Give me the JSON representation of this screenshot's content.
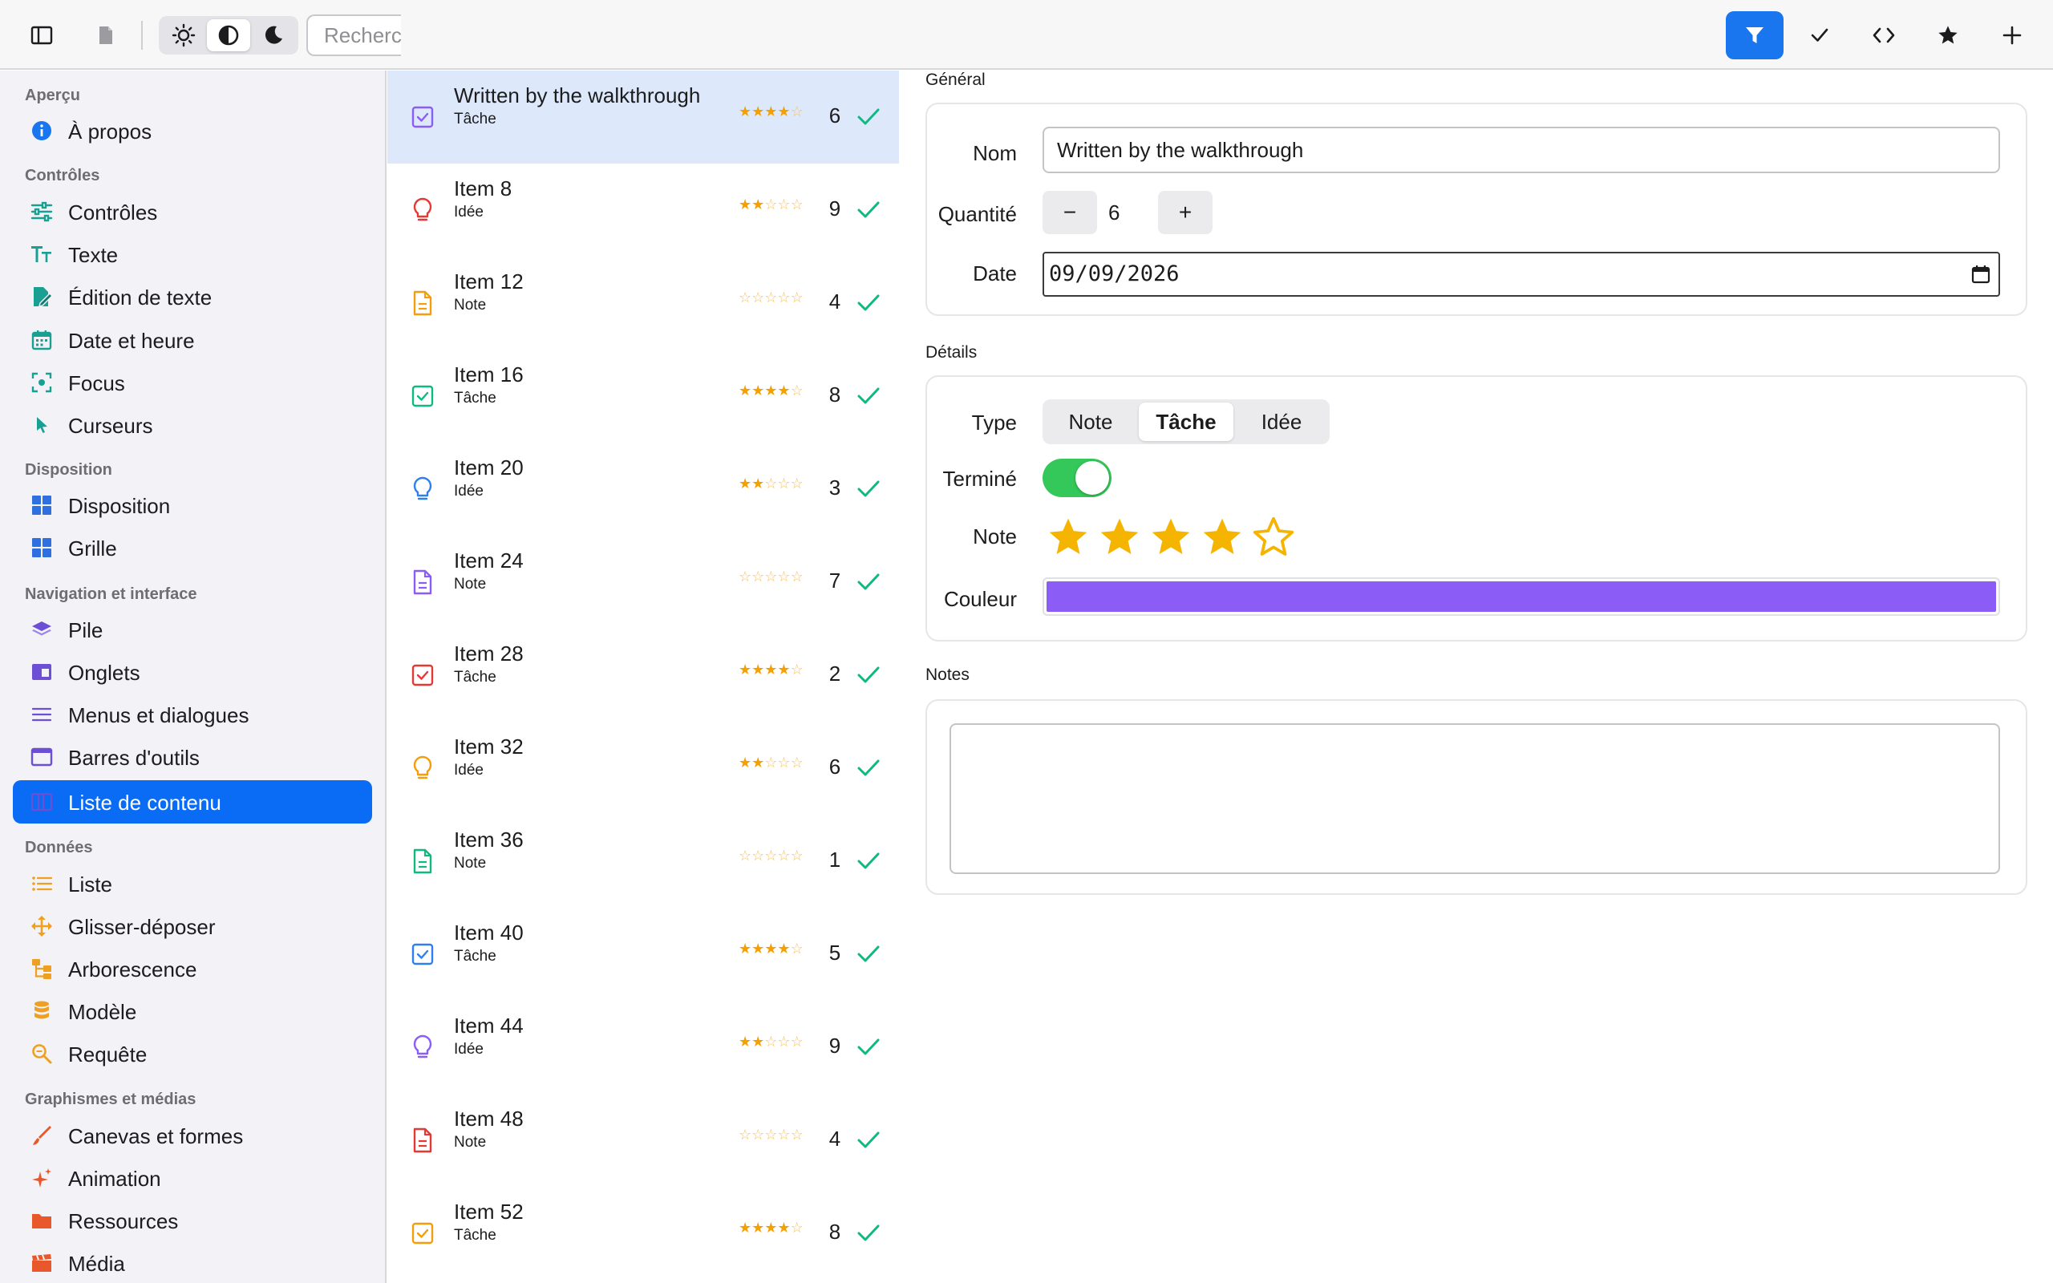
{
  "toolbar": {
    "search_placeholder": "Recherche",
    "colors": {
      "accent": "#1976ee"
    }
  },
  "sidebar": {
    "sections": [
      {
        "title": "Aperçu",
        "items": [
          {
            "label": "À propos",
            "icon": "info-icon"
          }
        ]
      },
      {
        "title": "Contrôles",
        "items": [
          {
            "label": "Contrôles",
            "icon": "sliders-icon"
          },
          {
            "label": "Texte",
            "icon": "text-format-icon"
          },
          {
            "label": "Édition de texte",
            "icon": "edit-doc-icon"
          },
          {
            "label": "Date et heure",
            "icon": "calendar-icon"
          },
          {
            "label": "Focus",
            "icon": "focus-icon"
          },
          {
            "label": "Curseurs",
            "icon": "cursor-icon"
          }
        ]
      },
      {
        "title": "Disposition",
        "items": [
          {
            "label": "Disposition",
            "icon": "layout-icon"
          },
          {
            "label": "Grille",
            "icon": "grid-icon"
          }
        ]
      },
      {
        "title": "Navigation et interface",
        "items": [
          {
            "label": "Pile",
            "icon": "stack-icon"
          },
          {
            "label": "Onglets",
            "icon": "tabs-icon"
          },
          {
            "label": "Menus et dialogues",
            "icon": "menu-icon"
          },
          {
            "label": "Barres d'outils",
            "icon": "toolbar-icon"
          },
          {
            "label": "Liste de contenu",
            "icon": "split-view-icon"
          }
        ]
      },
      {
        "title": "Données",
        "items": [
          {
            "label": "Liste",
            "icon": "list-icon"
          },
          {
            "label": "Glisser-déposer",
            "icon": "drag-icon"
          },
          {
            "label": "Arborescence",
            "icon": "tree-icon"
          },
          {
            "label": "Modèle",
            "icon": "database-icon"
          },
          {
            "label": "Requête",
            "icon": "search-doc-icon"
          }
        ]
      },
      {
        "title": "Graphismes et médias",
        "items": [
          {
            "label": "Canevas et formes",
            "icon": "brush-icon"
          },
          {
            "label": "Animation",
            "icon": "sparkle-icon"
          },
          {
            "label": "Ressources",
            "icon": "folder-icon"
          },
          {
            "label": "Média",
            "icon": "clapper-icon"
          }
        ]
      }
    ],
    "selected": "Liste de contenu"
  },
  "list": {
    "items": [
      {
        "title": "Written by the walkthrough",
        "type": "Tâche",
        "rating": 4,
        "qty": "6",
        "done": true,
        "icon": "task-icon",
        "color": "#8b5cf6",
        "selected": true
      },
      {
        "title": "Item 8",
        "type": "Idée",
        "rating": 2,
        "qty": "9",
        "done": true,
        "icon": "idea-icon",
        "color": "#e53935"
      },
      {
        "title": "Item 12",
        "type": "Note",
        "rating": 0,
        "qty": "4",
        "done": true,
        "icon": "note-icon",
        "color": "#f59e0b"
      },
      {
        "title": "Item 16",
        "type": "Tâche",
        "rating": 4,
        "qty": "8",
        "done": true,
        "icon": "task-icon",
        "color": "#10b981"
      },
      {
        "title": "Item 20",
        "type": "Idée",
        "rating": 2,
        "qty": "3",
        "done": true,
        "icon": "idea-icon",
        "color": "#2f80ed"
      },
      {
        "title": "Item 24",
        "type": "Note",
        "rating": 0,
        "qty": "7",
        "done": true,
        "icon": "note-icon",
        "color": "#8b5cf6"
      },
      {
        "title": "Item 28",
        "type": "Tâche",
        "rating": 4,
        "qty": "2",
        "done": true,
        "icon": "task-icon",
        "color": "#e53935"
      },
      {
        "title": "Item 32",
        "type": "Idée",
        "rating": 2,
        "qty": "6",
        "done": true,
        "icon": "idea-icon",
        "color": "#f59e0b"
      },
      {
        "title": "Item 36",
        "type": "Note",
        "rating": 0,
        "qty": "1",
        "done": true,
        "icon": "note-icon",
        "color": "#10b981"
      },
      {
        "title": "Item 40",
        "type": "Tâche",
        "rating": 4,
        "qty": "5",
        "done": true,
        "icon": "task-icon",
        "color": "#2f80ed"
      },
      {
        "title": "Item 44",
        "type": "Idée",
        "rating": 2,
        "qty": "9",
        "done": true,
        "icon": "idea-icon",
        "color": "#8b5cf6"
      },
      {
        "title": "Item 48",
        "type": "Note",
        "rating": 0,
        "qty": "4",
        "done": true,
        "icon": "note-icon",
        "color": "#e53935"
      },
      {
        "title": "Item 52",
        "type": "Tâche",
        "rating": 4,
        "qty": "8",
        "done": true,
        "icon": "task-icon",
        "color": "#f59e0b"
      }
    ]
  },
  "detail": {
    "general": {
      "title": "Général",
      "name_label": "Nom",
      "name_value": "Written by the walkthrough",
      "qty_label": "Quantité",
      "qty_minus": "−",
      "qty_value": "6",
      "qty_plus": "+",
      "date_label": "Date",
      "date_value": "09/09/2026"
    },
    "details": {
      "title": "Détails",
      "type_label": "Type",
      "type_options": [
        "Note",
        "Tâche",
        "Idée"
      ],
      "type_selected": "Tâche",
      "done_label": "Terminé",
      "done": true,
      "rating_label": "Note",
      "rating": 4,
      "rating_max": 5,
      "color_label": "Couleur",
      "color": "#8b5cf6"
    },
    "notes": {
      "title": "Notes",
      "value": ""
    }
  }
}
